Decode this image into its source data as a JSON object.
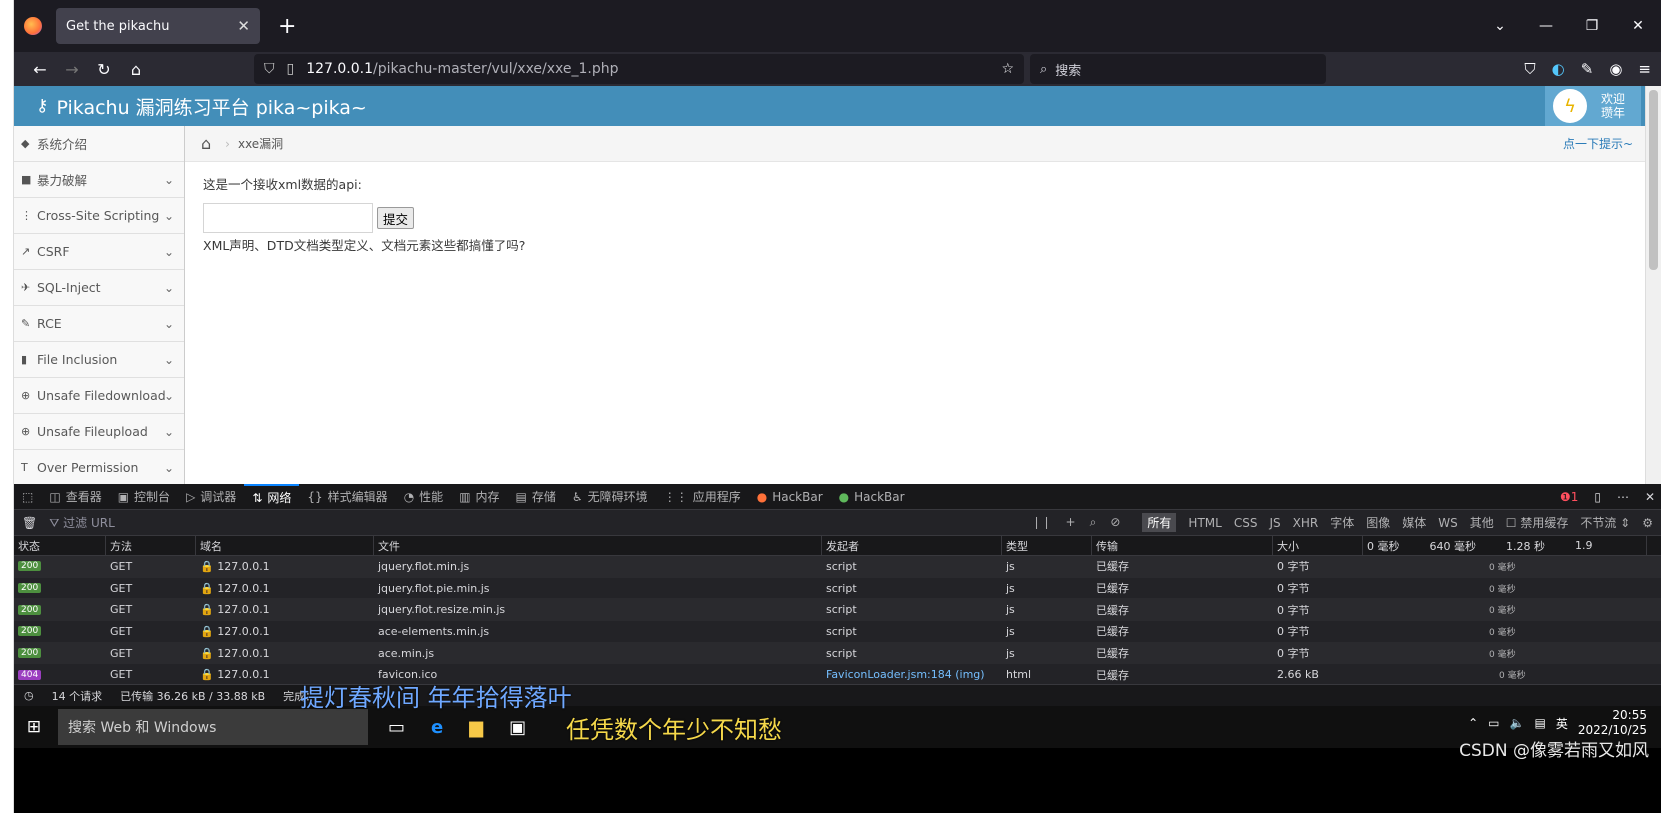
{
  "browser": {
    "tab_title": "Get the pikachu",
    "url_host": "127.0.0.1",
    "url_path": "/pikachu-master/vul/xxe/xxe_1.php",
    "search_placeholder": "搜索"
  },
  "app": {
    "title": "Pikachu 漏洞练习平台 pika~pika~",
    "user_greeting_line1": "欢迎",
    "user_greeting_line2": "瓒年"
  },
  "sidebar": {
    "items": [
      {
        "label": "系统介绍",
        "icon": "tag-icon"
      },
      {
        "label": "暴力破解",
        "icon": "lock-icon"
      },
      {
        "label": "Cross-Site Scripting",
        "icon": "list-icon"
      },
      {
        "label": "CSRF",
        "icon": "share-icon"
      },
      {
        "label": "SQL-Inject",
        "icon": "plane-icon"
      },
      {
        "label": "RCE",
        "icon": "pencil-icon"
      },
      {
        "label": "File Inclusion",
        "icon": "file-icon"
      },
      {
        "label": "Unsafe Filedownload",
        "icon": "download-icon"
      },
      {
        "label": "Unsafe Fileupload",
        "icon": "upload-icon"
      },
      {
        "label": "Over Permission",
        "icon": "text-icon"
      }
    ]
  },
  "breadcrumb": {
    "current": "xxe漏洞",
    "hint": "点一下提示~"
  },
  "main": {
    "intro": "这是一个接收xml数据的api:",
    "submit_label": "提交",
    "note": "XML声明、DTD文档类型定义、文档元素这些都搞懂了吗?"
  },
  "devtools": {
    "tabs": [
      "查看器",
      "控制台",
      "调试器",
      "网络",
      "样式编辑器",
      "性能",
      "内存",
      "存储",
      "无障碍环境",
      "应用程序",
      "HackBar",
      "HackBar"
    ],
    "active_tab": "网络",
    "error_count": "1",
    "filter_placeholder": "过滤 URL",
    "types": [
      "所有",
      "HTML",
      "CSS",
      "JS",
      "XHR",
      "字体",
      "图像",
      "媒体",
      "WS",
      "其他"
    ],
    "disable_cache": "禁用缓存",
    "throttle": "不节流",
    "columns": [
      "状态",
      "方法",
      "域名",
      "文件",
      "发起者",
      "类型",
      "传输",
      "大小",
      "0 毫秒",
      "640 毫秒",
      "1.28 秒",
      "1.9"
    ],
    "rows": [
      {
        "status": "200",
        "method": "GET",
        "domain": "127.0.0.1",
        "file": "jquery.flot.min.js",
        "initiator": "script",
        "type": "js",
        "transfer": "已缓存",
        "size": "0 字节",
        "wf": "0 毫秒"
      },
      {
        "status": "200",
        "method": "GET",
        "domain": "127.0.0.1",
        "file": "jquery.flot.pie.min.js",
        "initiator": "script",
        "type": "js",
        "transfer": "已缓存",
        "size": "0 字节",
        "wf": "0 毫秒"
      },
      {
        "status": "200",
        "method": "GET",
        "domain": "127.0.0.1",
        "file": "jquery.flot.resize.min.js",
        "initiator": "script",
        "type": "js",
        "transfer": "已缓存",
        "size": "0 字节",
        "wf": "0 毫秒"
      },
      {
        "status": "200",
        "method": "GET",
        "domain": "127.0.0.1",
        "file": "ace-elements.min.js",
        "initiator": "script",
        "type": "js",
        "transfer": "已缓存",
        "size": "0 字节",
        "wf": "0 毫秒"
      },
      {
        "status": "200",
        "method": "GET",
        "domain": "127.0.0.1",
        "file": "ace.min.js",
        "initiator": "script",
        "type": "js",
        "transfer": "已缓存",
        "size": "0 字节",
        "wf": "0 毫秒"
      },
      {
        "status": "404",
        "method": "GET",
        "domain": "127.0.0.1",
        "file": "favicon.ico",
        "initiator": "FaviconLoader.jsm:184 (img)",
        "type": "html",
        "transfer": "已缓存",
        "size": "2.66 kB",
        "wf": "0 毫秒"
      }
    ],
    "status": {
      "requests": "14 个请求",
      "transferred": "已传输 36.26 kB / 33.88 kB",
      "finish": "完成："
    }
  },
  "taskbar": {
    "search_placeholder": "搜索 Web 和 Windows",
    "time": "20:55",
    "date": "2022/10/25",
    "ime": "英"
  },
  "overlay": {
    "subtitle1": "提灯春秋间 年年拾得落叶",
    "subtitle2": "任凭数个年少不知愁",
    "watermark": "CSDN @像雾若雨又如风"
  }
}
